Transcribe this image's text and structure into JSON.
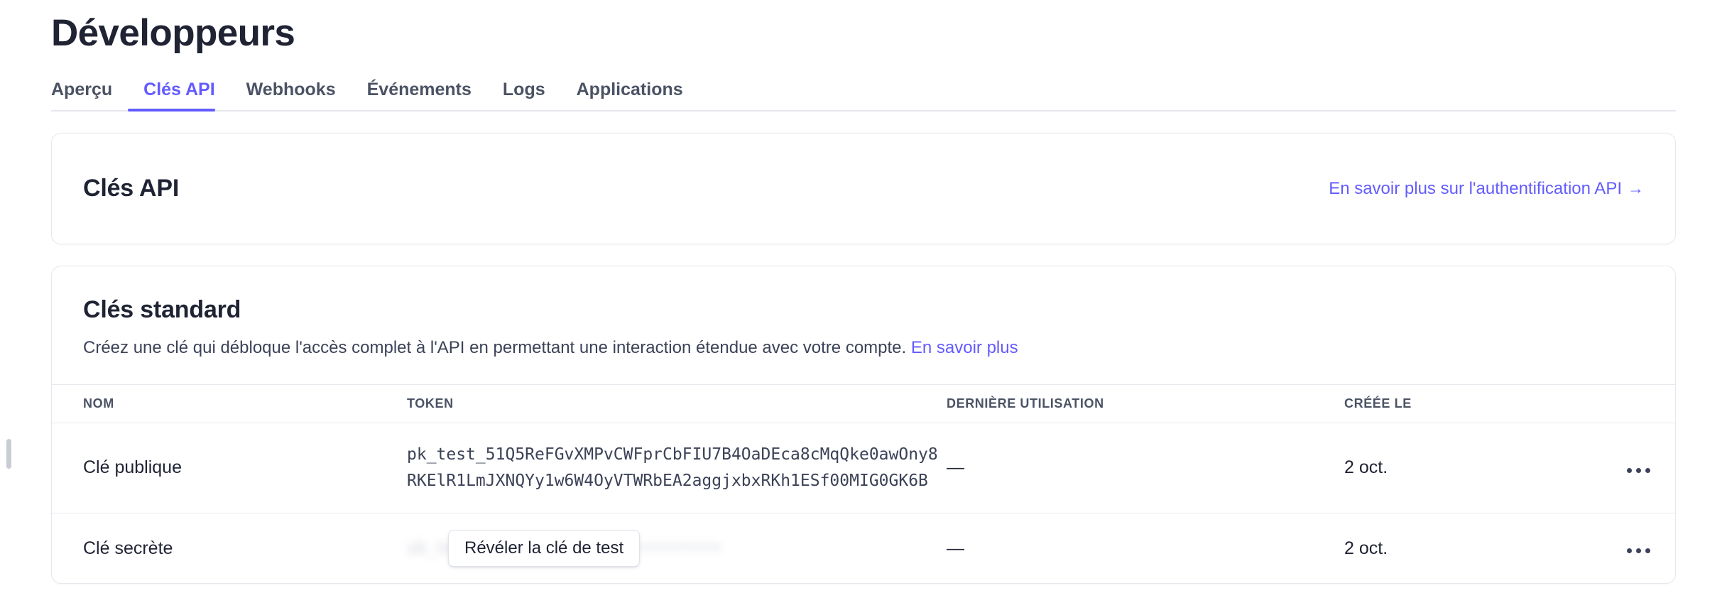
{
  "page": {
    "title": "Développeurs"
  },
  "tabs": [
    {
      "label": "Aperçu",
      "active": false
    },
    {
      "label": "Clés API",
      "active": true
    },
    {
      "label": "Webhooks",
      "active": false
    },
    {
      "label": "Événements",
      "active": false
    },
    {
      "label": "Logs",
      "active": false
    },
    {
      "label": "Applications",
      "active": false
    }
  ],
  "intro_card": {
    "title": "Clés API",
    "link_label": "En savoir plus sur l'authentification API",
    "link_arrow": "→"
  },
  "standard_keys": {
    "title": "Clés standard",
    "description": "Créez une clé qui débloque l'accès complet à l'API en permettant une interaction étendue avec votre compte.",
    "description_link": "En savoir plus",
    "columns": {
      "name": "NOM",
      "token": "TOKEN",
      "last_used": "DERNIÈRE UTILISATION",
      "created": "CRÉÉE LE"
    },
    "rows": [
      {
        "name": "Clé publique",
        "token": "pk_test_51Q5ReFGvXMPvCWFprCbFIU7B4OaDEca8cMqQke0awOny8RKElR1LmJXNQYy1w6W4OyVTWRbEA2aggjxbxRKh1ESf00MIG0GK6B",
        "token_masked": false,
        "last_used": "—",
        "created": "2 oct.",
        "menu_label": "•••"
      },
      {
        "name": "Clé secrète",
        "token": "sk_test_••••••••••••••••••••••••",
        "token_masked": true,
        "reveal_label": "Révéler la clé de test",
        "last_used": "—",
        "created": "2 oct.",
        "menu_label": "•••"
      }
    ]
  },
  "colors": {
    "accent": "#635bff",
    "text_primary": "#1f2333",
    "text_secondary": "#3c4257",
    "border": "#e6e8ee"
  }
}
